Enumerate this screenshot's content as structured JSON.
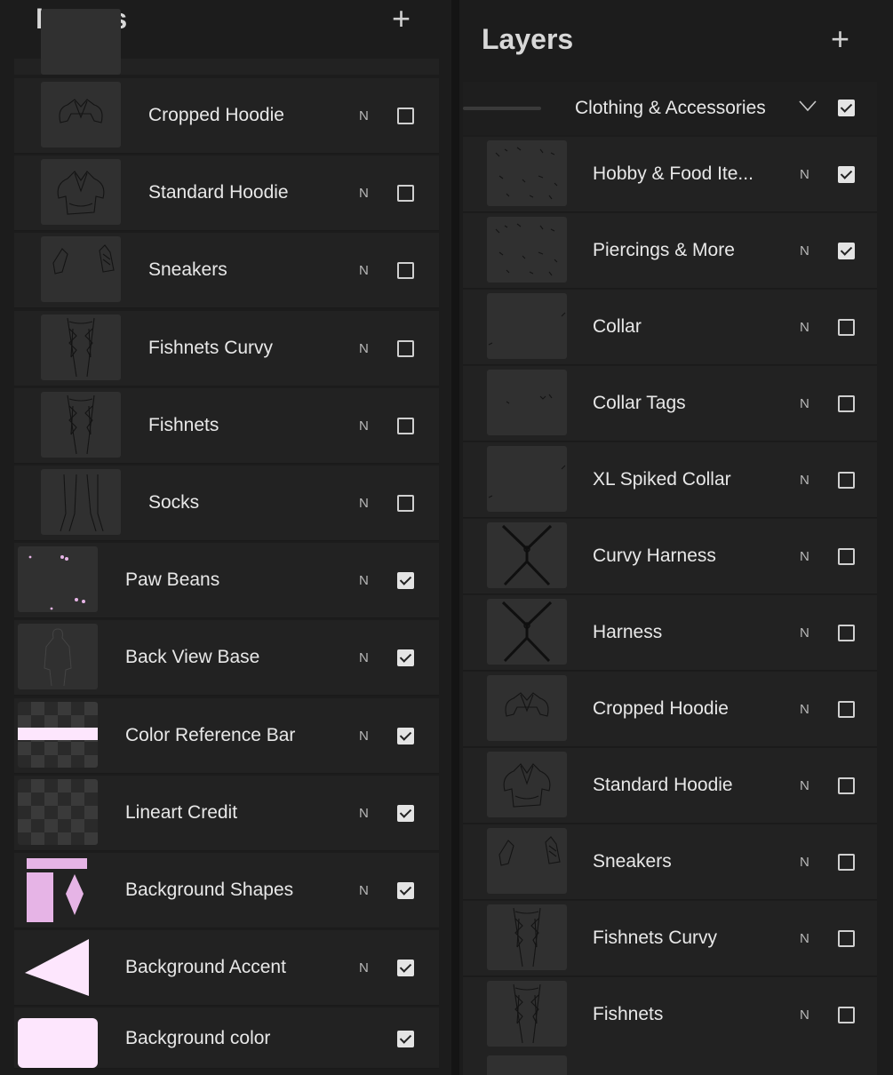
{
  "left": {
    "title": "Layers",
    "add_label": "+",
    "rows": [
      {
        "name": "Cropped Hoodie",
        "mode": "N",
        "checked": false,
        "thumb": "hoodie-cropped"
      },
      {
        "name": "Standard Hoodie",
        "mode": "N",
        "checked": false,
        "thumb": "hoodie"
      },
      {
        "name": "Sneakers",
        "mode": "N",
        "checked": false,
        "thumb": "sneakers"
      },
      {
        "name": "Fishnets Curvy",
        "mode": "N",
        "checked": false,
        "thumb": "fishnets"
      },
      {
        "name": "Fishnets",
        "mode": "N",
        "checked": false,
        "thumb": "fishnets"
      },
      {
        "name": "Socks",
        "mode": "N",
        "checked": false,
        "thumb": "socks"
      },
      {
        "name": "Paw Beans",
        "mode": "N",
        "checked": true,
        "thumb": "paw-beans"
      },
      {
        "name": "Back View Base",
        "mode": "N",
        "checked": true,
        "thumb": "body"
      },
      {
        "name": "Color Reference Bar",
        "mode": "N",
        "checked": true,
        "thumb": "color-bar"
      },
      {
        "name": "Lineart Credit",
        "mode": "N",
        "checked": true,
        "thumb": "checker"
      },
      {
        "name": "Background Shapes",
        "mode": "N",
        "checked": true,
        "thumb": "bg-shapes"
      },
      {
        "name": "Background Accent",
        "mode": "N",
        "checked": true,
        "thumb": "bg-accent"
      },
      {
        "name": "Background color",
        "mode": "",
        "checked": true,
        "thumb": "bg-color"
      }
    ]
  },
  "right": {
    "title": "Layers",
    "add_label": "+",
    "group": {
      "name": "Clothing & Accessories",
      "checked": true
    },
    "rows": [
      {
        "name": "Hobby & Food Ite...",
        "mode": "N",
        "checked": true,
        "thumb": "scatter"
      },
      {
        "name": "Piercings & More",
        "mode": "N",
        "checked": true,
        "thumb": "scatter"
      },
      {
        "name": "Collar",
        "mode": "N",
        "checked": false,
        "thumb": "collar"
      },
      {
        "name": "Collar Tags",
        "mode": "N",
        "checked": false,
        "thumb": "collar-tags"
      },
      {
        "name": "XL Spiked Collar",
        "mode": "N",
        "checked": false,
        "thumb": "collar"
      },
      {
        "name": "Curvy Harness",
        "mode": "N",
        "checked": false,
        "thumb": "harness"
      },
      {
        "name": "Harness",
        "mode": "N",
        "checked": false,
        "thumb": "harness"
      },
      {
        "name": "Cropped Hoodie",
        "mode": "N",
        "checked": false,
        "thumb": "hoodie-cropped"
      },
      {
        "name": "Standard Hoodie",
        "mode": "N",
        "checked": false,
        "thumb": "hoodie"
      },
      {
        "name": "Sneakers",
        "mode": "N",
        "checked": false,
        "thumb": "sneakers"
      },
      {
        "name": "Fishnets Curvy",
        "mode": "N",
        "checked": false,
        "thumb": "fishnets"
      },
      {
        "name": "Fishnets",
        "mode": "N",
        "checked": false,
        "thumb": "fishnets"
      }
    ]
  },
  "colors": {
    "panel": "#1c1c1c",
    "row": "#222222",
    "thumb": "#303030",
    "accent_pink": "#e6b4e6",
    "pale_pink": "#fde6fd"
  }
}
